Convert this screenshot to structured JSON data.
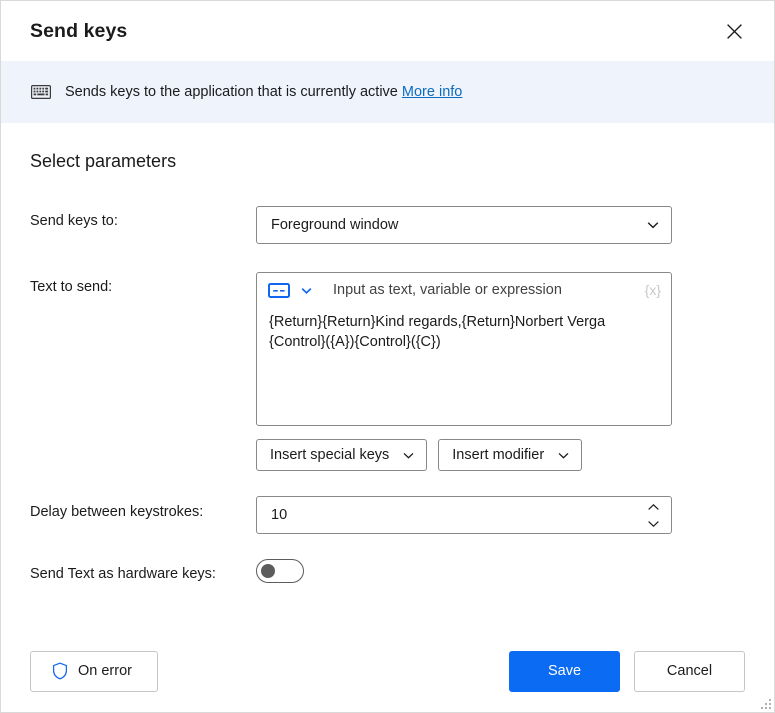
{
  "window": {
    "title": "Send keys",
    "close_icon": "close-icon",
    "resize_grip": "resize-grip"
  },
  "banner": {
    "icon": "keyboard-icon",
    "text": "Sends keys to the application that is currently active",
    "link_label": "More info",
    "background": "#eff3fc",
    "link_color": "#0f6cbd"
  },
  "section": {
    "title": "Select parameters"
  },
  "fields": {
    "send_keys_to": {
      "label": "Send keys to:",
      "value": "Foreground window",
      "chevron_icon": "chevron-down-icon",
      "info_icon": "info-icon"
    },
    "text_to_send": {
      "label": "Text to send:",
      "mode_icon": "text-input-mode-icon",
      "mode_chevron_icon": "chevron-down-icon",
      "placeholder": "Input as text, variable or expression",
      "expression_marker": "{x}",
      "value": "{Return}{Return}Kind regards,{Return}Norbert Verga\n{Control}({A}){Control}({C})",
      "info_icon": "info-icon",
      "insert_special_keys": {
        "label": "Insert special keys",
        "chevron_icon": "chevron-down-icon"
      },
      "insert_modifier": {
        "label": "Insert modifier",
        "chevron_icon": "chevron-down-icon"
      }
    },
    "delay_between_keystrokes": {
      "label": "Delay between keystrokes:",
      "value": "10",
      "up_icon": "chevron-up-icon",
      "down_icon": "chevron-down-icon",
      "info_icon": "info-icon"
    },
    "send_text_as_hardware_keys": {
      "label": "Send Text as hardware keys:",
      "state": "off",
      "info_icon": "info-icon"
    }
  },
  "footer": {
    "on_error": {
      "label": "On error",
      "icon": "shield-icon"
    },
    "save": {
      "label": "Save",
      "color": "#0b6bf2"
    },
    "cancel": {
      "label": "Cancel"
    }
  }
}
